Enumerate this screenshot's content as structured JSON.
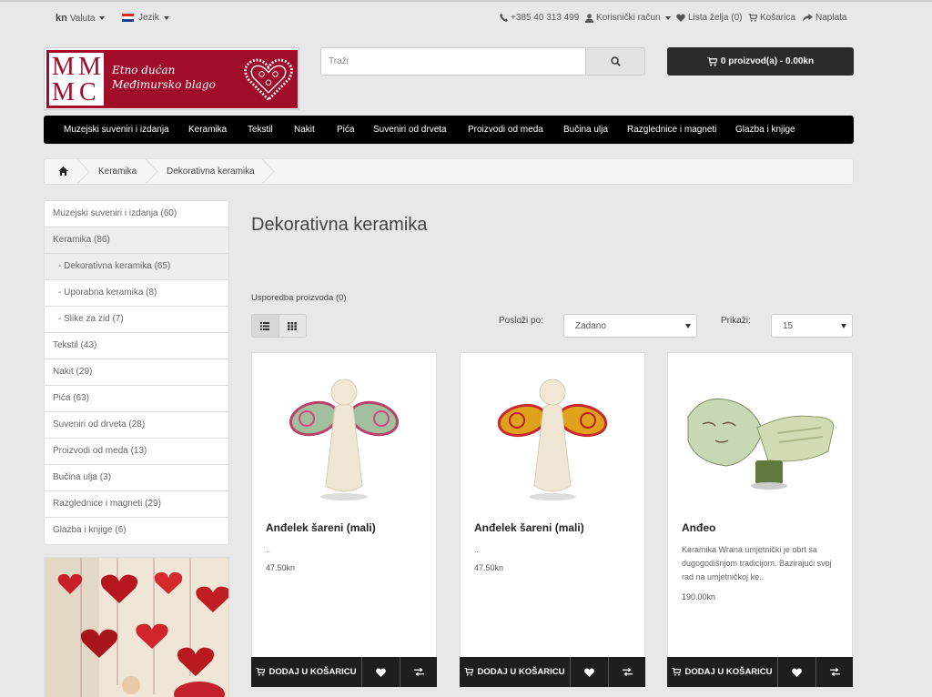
{
  "topbar": {
    "currency_symbol": "kn",
    "currency_label": "Valuta",
    "language_label": "Jezik",
    "phone": "+385 40 313 499",
    "account": "Korisnički račun",
    "wishlist": "Lista želja (0)",
    "cart": "Košarica",
    "checkout": "Naplata"
  },
  "logo": {
    "letters": [
      "M",
      "M",
      "M",
      "C"
    ],
    "line1": "Etno dućan",
    "line2": "Međimursko blago"
  },
  "search": {
    "placeholder": "Traži"
  },
  "cart_button": {
    "label": "0 proizvod(a) - 0.00kn"
  },
  "nav": {
    "items": [
      "Muzejski suveniri i izdanja",
      "Keramika",
      "Tekstil",
      "Nakit",
      "Pića",
      "Suveniri od drveta",
      "Proizvodi od meda",
      "Bučina ulja",
      "Razglednice i magneti",
      "Glazba i knjige"
    ]
  },
  "breadcrumb": {
    "items": [
      "Keramika",
      "Dekorativna keramika"
    ]
  },
  "sidebar": {
    "items": [
      "Muzejski suveniri i izdanja (60)",
      "Keramika (86)",
      "- Dekorativna keramika (65)",
      "- Uporabna keramika (8)",
      "- Slike za zid (7)",
      "Tekstil (43)",
      "Nakit (29)",
      "Pića (63)",
      "Suveniri od drveta (28)",
      "Proizvodi od meda (13)",
      "Bučina ulja (3)",
      "Razglednice i magneti (29)",
      "Glazba i knjige (6)"
    ]
  },
  "main": {
    "title": "Dekorativna keramika",
    "compare": "Usporedba proizvoda (0)",
    "sort_label": "Posloži po:",
    "sort_value": "Zadano",
    "limit_label": "Prikaži:",
    "limit_value": "15"
  },
  "products": [
    {
      "name": "Anđelek šareni (mali)",
      "desc": "..",
      "price": "47.50kn",
      "add_label": "DODAJ U KOŠARICU"
    },
    {
      "name": "Anđelek šareni (mali)",
      "desc": "..",
      "price": "47.50kn",
      "add_label": "DODAJ U KOŠARICU"
    },
    {
      "name": "Anđeo",
      "desc": "Keramika Wrana umjetnički je obrt sa dugogodišnjom tradicijom. Bazirajući svoj rad na umjetničkoj ke..",
      "price": "190.00kn",
      "add_label": "DODAJ U KOŠARICU"
    }
  ],
  "colors": {
    "brand": "#a00d2a",
    "nav_bg": "#000000",
    "button_dark": "#1e1e1e",
    "page_bg": "#e8e8e8"
  }
}
